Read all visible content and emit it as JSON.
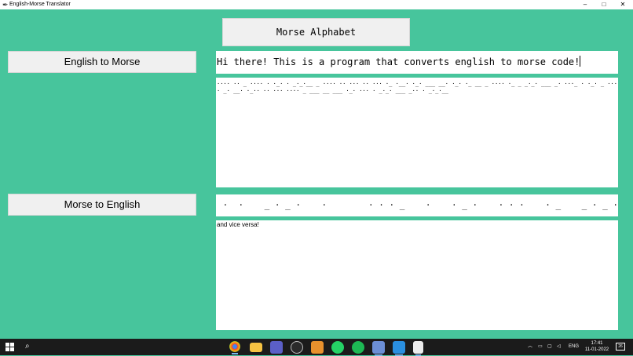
{
  "window": {
    "title": "English-Morse Translator",
    "controls": {
      "minimize": "–",
      "maximize": "□",
      "close": "✕"
    }
  },
  "buttons": {
    "alphabet": "Morse Alphabet",
    "english_to_morse": "English to Morse",
    "morse_to_english": "Morse to English"
  },
  "fields": {
    "english_input": "Hi there! This is a program that converts english to morse code!",
    "morse_output": "···· ··   _ ···· · ·_· ·  _·_·__   _ ···· ·· ···   ·· ···   ·_   ·__· ·_· ___ __· ·_· ·_ __   _ ···· ·_ _   _·_· ___ _· ···_ · ·_· _ ···   · _· __· ·_·· ·· ··· ····   _ ___   __ ___ ·_· ··· ·   _·_· ___ _·· ·  _·_·__",
    "morse_input": " ·  ·    _ · _ ·    ·        · · · _    ·    · _ ·    · · ·    · _    _ · _ · _ _",
    "english_output": "and vice versa!"
  },
  "taskbar": {
    "icons": [
      "windows-start-icon",
      "search-icon",
      "chrome-icon",
      "file-explorer-icon",
      "teams-icon",
      "browser-icon",
      "sublime-text-icon",
      "whatsapp-icon",
      "spotify-icon",
      "visual-studio-icon",
      "vscode-icon",
      "python-app-icon"
    ],
    "language": "ENG",
    "time": "17:41",
    "date": "11-01-2022",
    "notifications": "26"
  },
  "colors": {
    "app_background": "#47c59c",
    "button_background": "#f0f0f0",
    "taskbar_background": "#1b1b1b"
  }
}
